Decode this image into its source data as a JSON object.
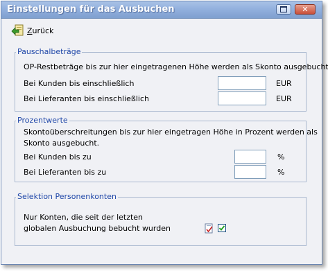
{
  "window": {
    "title": "Einstellungen für das Ausbuchen",
    "restore_icon": "restore-icon",
    "close_icon": "close-icon",
    "close_glyph": "✕"
  },
  "toolbar": {
    "back_icon": "back-arrow-folder-icon",
    "back_label_accel": "Z",
    "back_label_rest": "urück"
  },
  "pauschal": {
    "legend": "Pauschalbeträge",
    "description": "OP-Restbeträge bis zur hier eingetragenen Höhe werden als Skonto ausgebucht.",
    "kunden_label": "Bei Kunden bis einschließlich",
    "kunden_value": "",
    "kunden_unit": "EUR",
    "lieferanten_label": "Bei Lieferanten bis einschließlich",
    "lieferanten_value": "",
    "lieferanten_unit": "EUR"
  },
  "prozent": {
    "legend": "Prozentwerte",
    "description_line1": "Skontoüberschreitungen bis zur hier eingetragen Höhe in Prozent werden als",
    "description_line2": "Skonto ausgebucht.",
    "kunden_label": "Bei Kunden bis zu",
    "kunden_value": "",
    "kunden_unit": "%",
    "lieferanten_label": "Bei Lieferanten bis zu",
    "lieferanten_value": "",
    "lieferanten_unit": "%"
  },
  "selektion": {
    "legend": "Selektion Personenkonten",
    "line1": "Nur Konten, die seit der letzten",
    "line2": "globalen Ausbuchung bebucht wurden",
    "doc_icon": "document-check-icon",
    "checked": true
  },
  "colors": {
    "title_bar": "#93b1de",
    "legend_text": "#1f47a8",
    "group_border": "#a9b8cf",
    "window_bg": "#f0f1f5"
  }
}
